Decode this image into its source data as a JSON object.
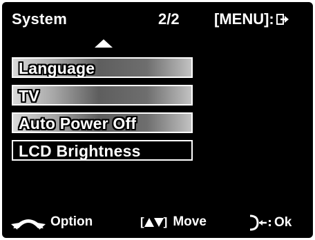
{
  "header": {
    "title": "System",
    "page_indicator": "2/2",
    "menu_label": "[MENU]:",
    "exit_icon": "exit-arrow-icon"
  },
  "menu": {
    "items": [
      {
        "label": "Language",
        "selected": false
      },
      {
        "label": "TV",
        "selected": false
      },
      {
        "label": "Auto Power Off",
        "selected": false
      },
      {
        "label": "LCD Brightness",
        "selected": true
      }
    ]
  },
  "footer": {
    "option_label": "Option",
    "move_brackets_open": "[",
    "move_brackets_close": "]",
    "move_label": "Move",
    "ok_label": "Ok"
  },
  "colors": {
    "background": "#000000",
    "text": "#ffffff",
    "item_gradient_light": "#d9d9d9",
    "item_gradient_dark": "#5e5e5e"
  }
}
